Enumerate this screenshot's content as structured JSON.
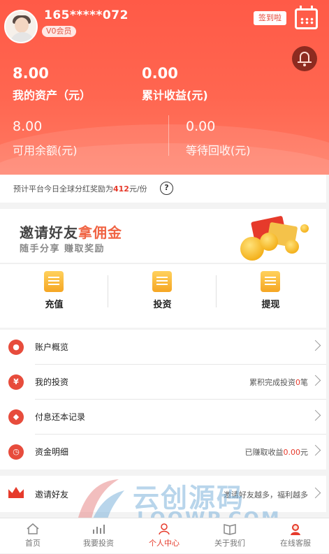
{
  "user": {
    "phone": "165*****072",
    "vip": "V0会员",
    "checkin": "签到啦"
  },
  "stats": {
    "assets_value": "8.00",
    "assets_label": "我的资产（元）",
    "earnings_value": "0.00",
    "earnings_label": "累计收益(元)",
    "available_value": "8.00",
    "available_label": "可用余额(元)",
    "pending_value": "0.00",
    "pending_label": "等待回收(元)"
  },
  "notice": {
    "prefix": "预计平台今日全球分红奖励为",
    "amount": "412",
    "suffix": "元/份",
    "help": "?"
  },
  "banner": {
    "title_a": "邀请好友",
    "title_b": "拿佣金",
    "subtitle": "随手分享 赚取奖励"
  },
  "actions": [
    {
      "label": "充值",
      "icon": "wallet-icon"
    },
    {
      "label": "投资",
      "icon": "document-icon"
    },
    {
      "label": "提现",
      "icon": "gift-icon"
    }
  ],
  "menu": [
    {
      "label": "账户概览",
      "icon": "user-icon",
      "right": ""
    },
    {
      "label": "我的投资",
      "icon": "yen-icon",
      "right_prefix": "累积完成投资",
      "right_value": "0",
      "right_suffix": "笔"
    },
    {
      "label": "付息还本记录",
      "icon": "diamond-icon",
      "right": ""
    },
    {
      "label": "资金明细",
      "icon": "clock-icon",
      "right_prefix": "已赚取收益",
      "right_value": "0.00",
      "right_suffix": "元"
    }
  ],
  "invite": {
    "label": "邀请好友",
    "right": "邀请好友越多，福利越多"
  },
  "watermark": {
    "title": "云创源码",
    "url": "LOOWP.COM"
  },
  "tabs": [
    {
      "label": "首页",
      "icon": "home-icon"
    },
    {
      "label": "我要投资",
      "icon": "chart-icon"
    },
    {
      "label": "个人中心",
      "icon": "person-icon"
    },
    {
      "label": "关于我们",
      "icon": "book-icon"
    },
    {
      "label": "在线客服",
      "icon": "service-icon"
    }
  ],
  "colors": {
    "primary": "#ff5a47",
    "accent_red": "#e63a2b",
    "gold": "#f5a623"
  }
}
